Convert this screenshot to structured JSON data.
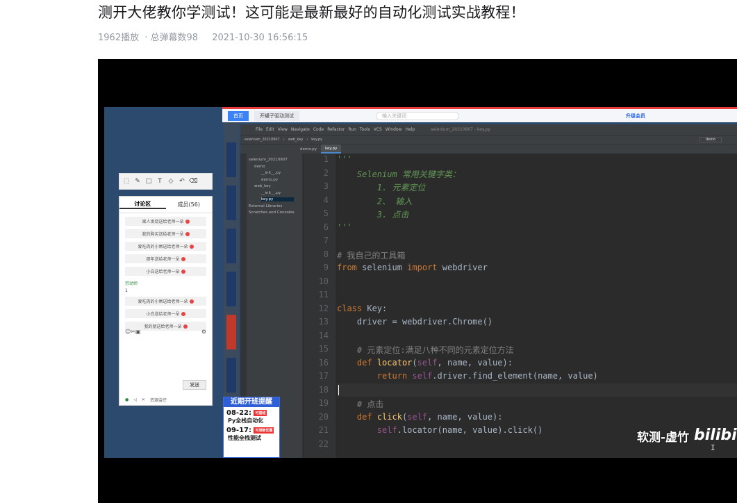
{
  "video": {
    "title": "测开大佬教你学测试！这可能是最新最好的自动化测试实战教程！",
    "views": "1962播放",
    "danmaku": "· 总弹幕数98",
    "date": "2021-10-30 16:56:15"
  },
  "browser": {
    "tab1": "首页",
    "tab2": "开罐子驱动测试",
    "address_placeholder": "输入关键词",
    "vip": "升级会员"
  },
  "chat": {
    "tab_discuss": "讨论区",
    "tab_members": "成员(56)",
    "messages": [
      "果人发烧送给老师一朵",
      "我的购买送给老师一朵",
      "爱吃肉的小屌送给老师一朵",
      "那年送给老师一朵",
      "小白送给老师一朵"
    ],
    "user": "劳动师",
    "user_msg": "1",
    "messages2": [
      "爱吃肉的小屌送给老师一朵",
      "小白送给老师一朵",
      "我的朋送给老师一朵"
    ],
    "send": "发送",
    "footer": "资源监控"
  },
  "ide": {
    "menu": [
      "File",
      "Edit",
      "View",
      "Navigate",
      "Code",
      "Refactor",
      "Run",
      "Tools",
      "VCS",
      "Window",
      "Help"
    ],
    "project_title": "selenium_20210907 - key.py",
    "breadcrumb": [
      "selenium_20210907",
      "web_key",
      "key.py"
    ],
    "run_config": "demo",
    "tabs": [
      "demo.py",
      "key.py"
    ],
    "tree": [
      "selenium_20210907",
      "demo",
      "__init__.py",
      "demo.py",
      "web_key",
      "__init__.py",
      "key.py",
      "External Libraries",
      "Scratches and Consoles"
    ],
    "current_line": 18,
    "code": [
      {
        "n": "1",
        "t": "'''",
        "cls": "d"
      },
      {
        "n": "2",
        "t": "    Selenium 常用关键字类：",
        "cls": "d"
      },
      {
        "n": "3",
        "t": "        1. 元素定位",
        "cls": "d"
      },
      {
        "n": "4",
        "t": "        2、 输入",
        "cls": "d"
      },
      {
        "n": "5",
        "t": "        3. 点击",
        "cls": "d"
      },
      {
        "n": "6",
        "t": "'''",
        "cls": "d"
      },
      {
        "n": "7",
        "t": "",
        "cls": ""
      },
      {
        "n": "8",
        "t": "# 我自己的工具箱",
        "cls": "c"
      },
      {
        "n": "9",
        "t": "from selenium import webdriver",
        "cls": ""
      },
      {
        "n": "10",
        "t": "",
        "cls": ""
      },
      {
        "n": "11",
        "t": "",
        "cls": ""
      },
      {
        "n": "12",
        "t": "class Key:",
        "cls": ""
      },
      {
        "n": "13",
        "t": "    driver = webdriver.Chrome()",
        "cls": ""
      },
      {
        "n": "14",
        "t": "",
        "cls": ""
      },
      {
        "n": "15",
        "t": "    # 元素定位:满足八种不同的元素定位方法",
        "cls": "c"
      },
      {
        "n": "16",
        "t": "    def locator(self, name, value):",
        "cls": ""
      },
      {
        "n": "17",
        "t": "        return self.driver.find_element(name, value)",
        "cls": ""
      },
      {
        "n": "18",
        "t": "",
        "cls": ""
      },
      {
        "n": "19",
        "t": "    # 点击",
        "cls": "c"
      },
      {
        "n": "20",
        "t": "    def click(self, name, value):",
        "cls": ""
      },
      {
        "n": "21",
        "t": "        self.locator(name, value).click()",
        "cls": ""
      },
      {
        "n": "22",
        "t": "",
        "cls": ""
      }
    ]
  },
  "banner": {
    "heading": "近期开班提醒",
    "item1_date": "08-22:",
    "item1_tag": "可插班",
    "item1_name": "Py全栈自动化",
    "item2_date": "09-17:",
    "item2_tag": "可领新优惠",
    "item2_name": "性能全栈测试"
  },
  "watermark": "软测-虚竹",
  "logo_text": "bilibili"
}
